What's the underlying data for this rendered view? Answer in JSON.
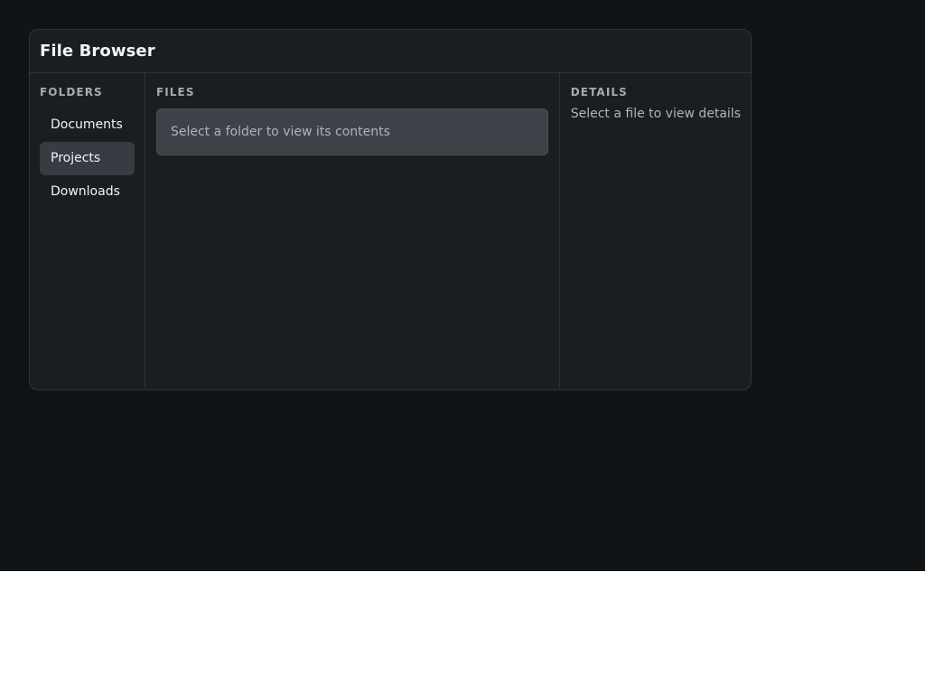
{
  "window": {
    "title": "File Browser"
  },
  "folders": {
    "heading": "FOLDERS",
    "items": [
      {
        "label": "Documents",
        "selected": false
      },
      {
        "label": "Projects",
        "selected": true
      },
      {
        "label": "Downloads",
        "selected": false
      }
    ]
  },
  "files": {
    "heading": "FILES",
    "empty_message": "Select a folder to view its contents"
  },
  "details": {
    "heading": "DETAILS",
    "empty_message": "Select a file to view details"
  },
  "colors": {
    "app_background": "#111416",
    "panel_background": "#1b1e21",
    "selected_item": "#383c42",
    "empty_state_background": "#3e4248"
  }
}
